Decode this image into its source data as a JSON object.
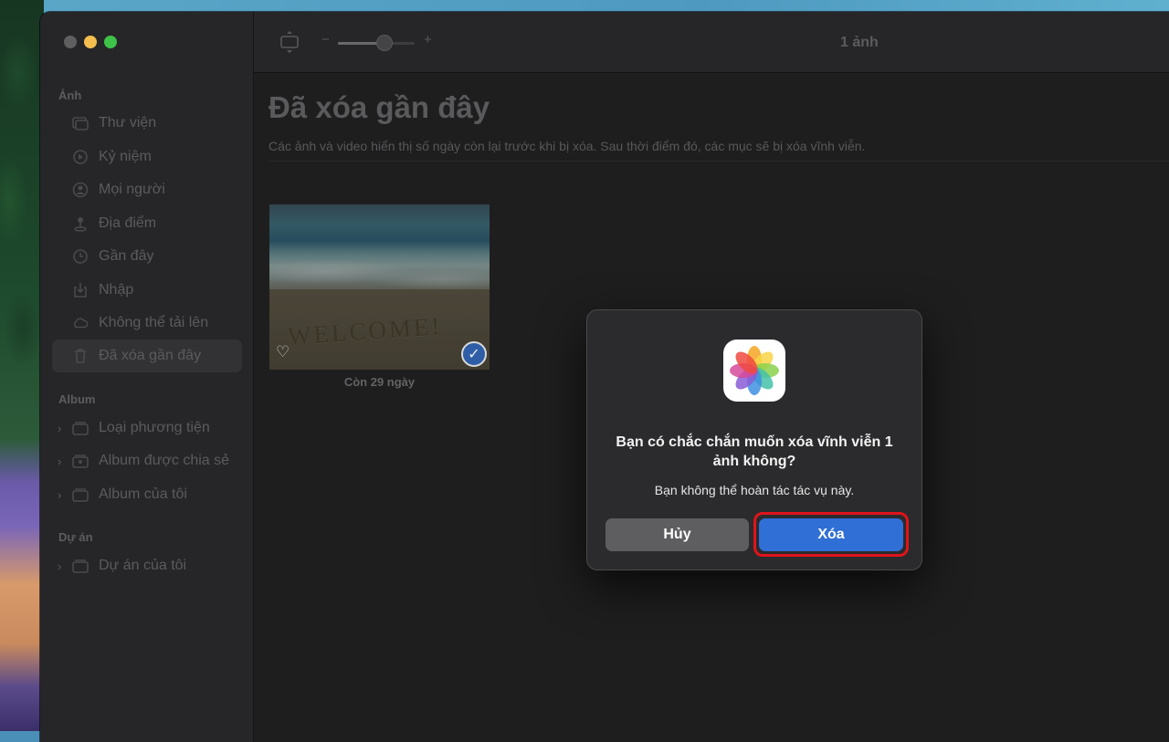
{
  "window": {
    "photo_count": "1 ảnh"
  },
  "sidebar": {
    "sections": [
      {
        "title": "Ảnh"
      },
      {
        "title": "Album"
      },
      {
        "title": "Dự án"
      }
    ],
    "items": [
      {
        "label": "Thư viện",
        "icon": "photo-library-icon"
      },
      {
        "label": "Kỷ niệm",
        "icon": "memories-icon"
      },
      {
        "label": "Mọi người",
        "icon": "people-icon"
      },
      {
        "label": "Địa điểm",
        "icon": "places-icon"
      },
      {
        "label": "Gần đây",
        "icon": "clock-icon"
      },
      {
        "label": "Nhập",
        "icon": "import-icon"
      },
      {
        "label": "Không thể tải lên",
        "icon": "cloud-icon"
      },
      {
        "label": "Đã xóa gần đây",
        "icon": "trash-icon",
        "selected": true
      }
    ],
    "album_items": [
      {
        "label": "Loại phương tiện",
        "icon": "folder-icon"
      },
      {
        "label": "Album được chia sẻ",
        "icon": "shared-album-icon"
      },
      {
        "label": "Album của tôi",
        "icon": "folder-icon"
      }
    ],
    "project_items": [
      {
        "label": "Dự án của tôi",
        "icon": "folder-icon"
      }
    ]
  },
  "toolbar": {
    "zoom_minus": "−",
    "zoom_plus": "+",
    "zoom_level": 0.6
  },
  "main": {
    "title": "Đã xóa gần đây",
    "description": "Các ảnh và video hiển thị số ngày còn lại trước khi bị xóa. Sau thời điểm đó, các mục sẽ bị xóa vĩnh viễn.",
    "photos": [
      {
        "caption": "Còn 29 ngày",
        "photo_text": "WELCOME!",
        "selected": true,
        "favorite": false
      }
    ]
  },
  "dialog": {
    "title": "Bạn có chắc chắn muốn xóa vĩnh viễn 1 ảnh không?",
    "message": "Bạn không thể hoàn tác tác vụ này.",
    "cancel_label": "Hủy",
    "delete_label": "Xóa",
    "accent_color": "#2f6fd6",
    "highlight_color": "#e0141b"
  }
}
